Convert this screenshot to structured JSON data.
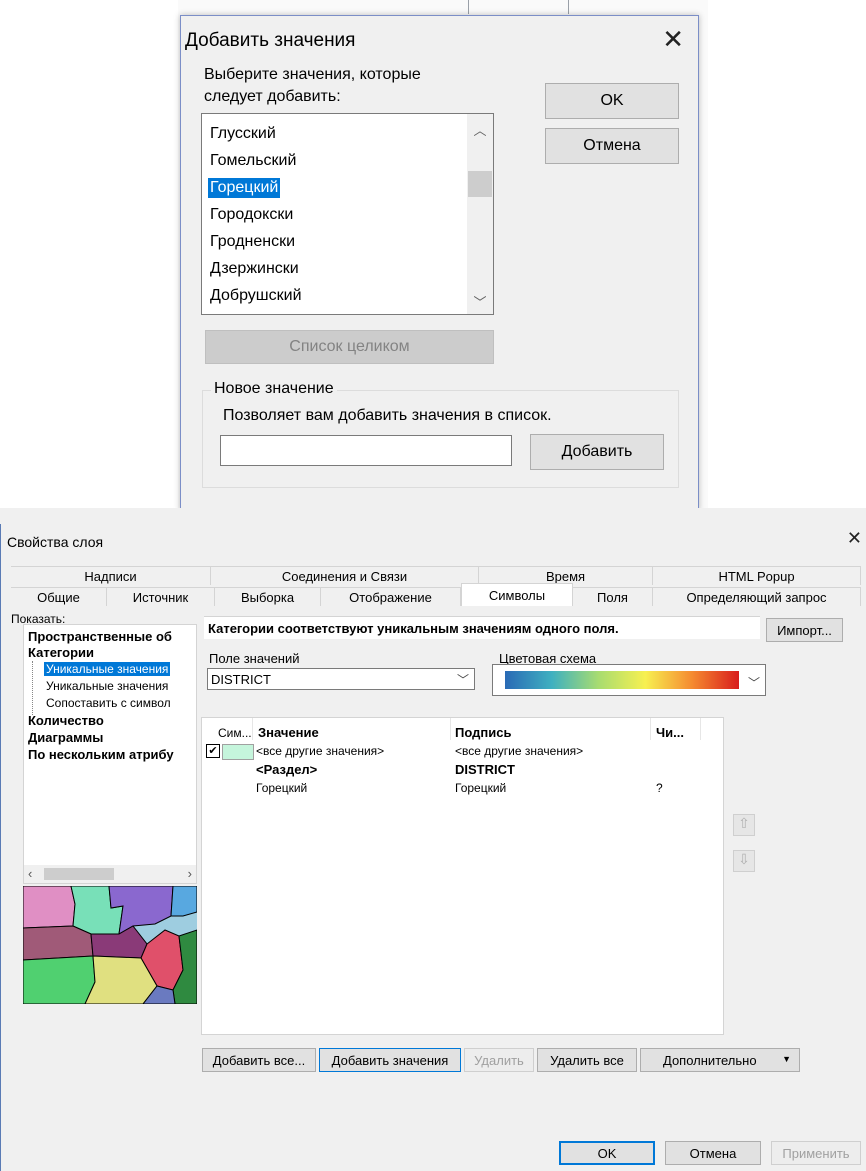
{
  "add_values_dialog": {
    "title": "Добавить значения",
    "prompt_line1": "Выберите значения, которые",
    "prompt_line2": "следует добавить:",
    "ok_label": "OK",
    "cancel_label": "Отмена",
    "list_items": [
      "Глусский",
      "Гомельский",
      "Горецкий",
      "Городокски",
      "Гродненски",
      "Дзержински",
      "Добрушский"
    ],
    "selected_item": "Горецкий",
    "full_list_label": "Список целиком",
    "new_value_group": "Новое значение",
    "new_value_hint": "Позволяет вам добавить значения в список.",
    "new_value_input": "",
    "add_label": "Добавить"
  },
  "layer_properties": {
    "title": "Свойства слоя",
    "tabs_row1": [
      "Надписи",
      "Соединения и Связи",
      "Время",
      "HTML Popup"
    ],
    "tabs_row2": [
      "Общие",
      "Источник",
      "Выборка",
      "Отображение",
      "Символы",
      "Поля",
      "Определяющий запрос"
    ],
    "active_tab": "Символы",
    "show_label": "Показать:",
    "tree": {
      "spatial": "Пространственные об",
      "categories": "Категории",
      "unique_values": "Уникальные значения",
      "unique_values_many": "Уникальные значения",
      "match_symbols": "Сопоставить с символ",
      "quantity": "Количество",
      "charts": "Диаграммы",
      "multiple_attrs": "По нескольким атрибу"
    },
    "description": "Категории соответствуют уникальным значениям одного поля.",
    "import_label": "Импорт...",
    "value_field_label": "Поле значений",
    "value_field_value": "DISTRICT",
    "color_scheme_label": "Цветовая схема",
    "table_headers": [
      "Сим...",
      "Значение",
      "Подпись",
      "Чи..."
    ],
    "rows": [
      {
        "value": "<все другие значения>",
        "label": "<все другие значения>",
        "count": ""
      },
      {
        "value": "<Раздел>",
        "label": "DISTRICT",
        "count": ""
      },
      {
        "value": "Горецкий",
        "label": "Горецкий",
        "count": "?"
      }
    ],
    "buttons": {
      "add_all": "Добавить все...",
      "add_values": "Добавить значения",
      "remove": "Удалить",
      "remove_all": "Удалить все",
      "advanced": "Дополнительно"
    },
    "ok_label": "OK",
    "cancel_label": "Отмена",
    "apply_label": "Применить"
  },
  "colors": {
    "selection": "#0078d7",
    "symbol_fill": "#c5f5dc"
  }
}
